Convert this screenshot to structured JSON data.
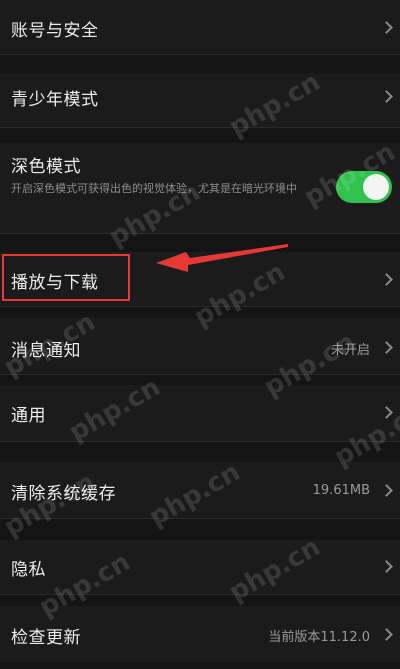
{
  "settings": {
    "items": [
      {
        "label": "账号与安全"
      },
      {
        "label": "青少年模式"
      },
      {
        "label": "深色模式",
        "description": "开启深色模式可获得出色的视觉体验，尤其是在暗光环境中",
        "toggle_on": true
      },
      {
        "label": "播放与下载"
      },
      {
        "label": "消息通知",
        "value": "未开启"
      },
      {
        "label": "通用"
      },
      {
        "label": "清除系统缓存",
        "value": "19.61MB"
      },
      {
        "label": "隐私"
      },
      {
        "label": "检查更新",
        "value": "当前版本11.12.0"
      }
    ]
  },
  "watermark": {
    "text": "php.cn"
  },
  "colors": {
    "background": "#141414",
    "row": "#1b1b1b",
    "toggle_on": "#2fc24d",
    "annotation_red": "#e53935"
  },
  "icons": {
    "chevron": "chevron-right-icon",
    "annotation_arrow": "arrow-left-icon"
  }
}
